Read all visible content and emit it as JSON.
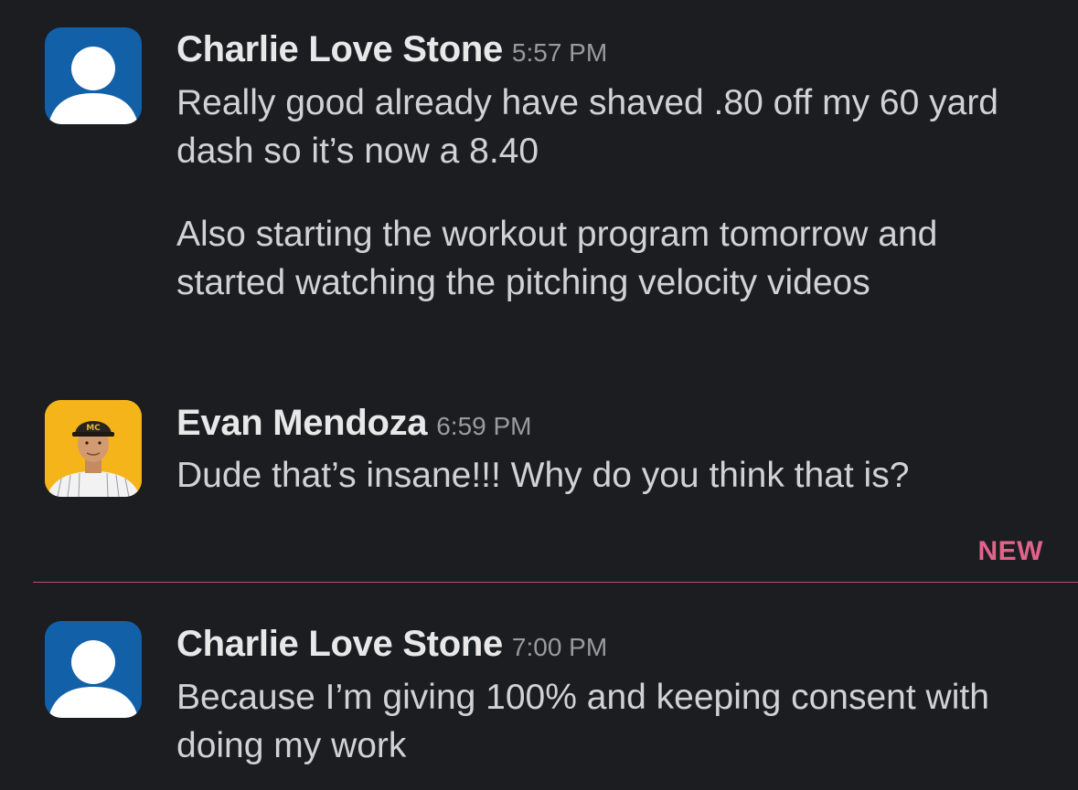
{
  "messages": [
    {
      "author": "Charlie Love Stone",
      "time": "5:57 PM",
      "avatar": "default-user-icon",
      "paragraphs": [
        "Really good already have shaved .80 off my 60 yard dash so it’s now a 8.40",
        "Also starting the workout program tomorrow and started watching the pitching velocity videos"
      ]
    },
    {
      "author": "Evan Mendoza",
      "time": "6:59 PM",
      "avatar": "profile-photo",
      "paragraphs": [
        "Dude that’s insane!!! Why do you think that is?"
      ]
    },
    {
      "author": "Charlie Love Stone",
      "time": "7:00 PM",
      "avatar": "default-user-icon",
      "paragraphs": [
        "Because I’m giving 100% and keeping consent with doing my work"
      ]
    }
  ],
  "new_divider": {
    "label": "NEW",
    "color": "#e3628a"
  },
  "colors": {
    "background": "#1b1d21",
    "default_avatar": "#1260a8",
    "photo_avatar_bg": "#f4b41a"
  }
}
